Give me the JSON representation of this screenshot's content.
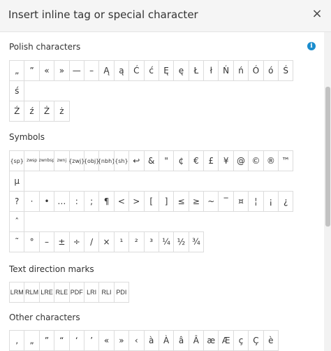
{
  "dialog": {
    "title": "Insert inline tag or special character",
    "close_label": "×",
    "info_label": "i"
  },
  "sections": {
    "polish": "Polish characters",
    "symbols": "Symbols",
    "text_direction": "Text direction marks",
    "other": "Other characters"
  },
  "polish_chars": [
    "„",
    "”",
    "«",
    "»",
    "—",
    "–",
    "Ą",
    "ą",
    "Ć",
    "ć",
    "Ę",
    "ę",
    "Ł",
    "ł",
    "Ń",
    "ń",
    "Ó",
    "ó",
    "Ś",
    "ś",
    "Ź",
    "ź",
    "Ż",
    "ż"
  ],
  "symbol_chars": [
    "{sp}",
    "zwsp",
    "zwnbsp",
    "zwnj",
    "{zwj}",
    "{obj}",
    "{nbh}",
    "{sh}",
    "↩",
    "&",
    "\"",
    "¢",
    "€",
    "£",
    "¥",
    "@",
    "©",
    "®",
    "™",
    "µ",
    "?",
    "·",
    "•",
    "…",
    ":",
    ";",
    "¶",
    "<",
    ">",
    "[",
    "]",
    "≤",
    "≥",
    "~",
    "‾",
    "¤",
    "¦",
    "¡",
    "¿",
    "ˆ",
    "˜",
    "°",
    "–",
    "±",
    "÷",
    "/",
    "×",
    "¹",
    "²",
    "³",
    "¼",
    "½",
    "¾"
  ],
  "direction_marks": [
    "LRM",
    "RLM",
    "LRE",
    "RLE",
    "PDF",
    "LRI",
    "RLI",
    "PDI"
  ],
  "other_chars": [
    "‚",
    "„",
    "”",
    "“",
    "‘",
    "’",
    "«",
    "»",
    "‹",
    "à",
    "À",
    "â",
    "Â",
    "æ",
    "Æ",
    "ç",
    "Ç",
    "è"
  ]
}
